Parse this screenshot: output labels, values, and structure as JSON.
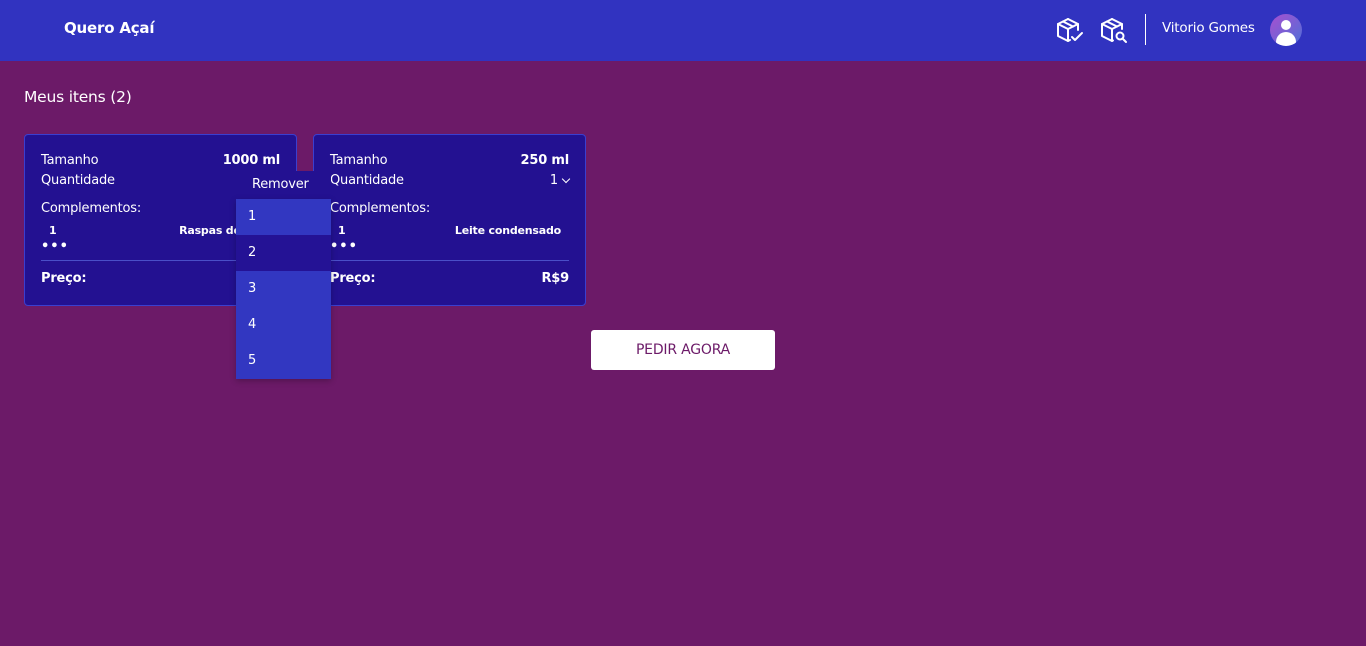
{
  "header": {
    "brand": "Quero Açaí",
    "user_name": "Vitorio Gomes",
    "icons": [
      "package-check-icon",
      "package-search-icon",
      "avatar-icon"
    ]
  },
  "main": {
    "title": "Meus itens (2)",
    "items": [
      {
        "size_label": "Tamanho",
        "size_value": "1000 ml",
        "qty_label": "Quantidade",
        "remove_label": "Remover",
        "complements_label": "Complementos:",
        "complement_qty": "1",
        "complement_name": "Raspas de choc",
        "more": "•••",
        "price_label": "Preço:"
      },
      {
        "size_label": "Tamanho",
        "size_value": "250 ml",
        "qty_label": "Quantidade",
        "qty_value": "1",
        "complements_label": "Complementos:",
        "complement_qty": "1",
        "complement_name": "Leite condensado",
        "more": "•••",
        "price_label": "Preço:",
        "price_value": "R$9"
      }
    ],
    "qty_options": [
      "1",
      "2",
      "3",
      "4",
      "5"
    ],
    "order_button": "PEDIR AGORA"
  },
  "colors": {
    "background": "#6c1a68",
    "header": "#3133c0",
    "card": "#231191",
    "dropdown": "#3237c1"
  }
}
